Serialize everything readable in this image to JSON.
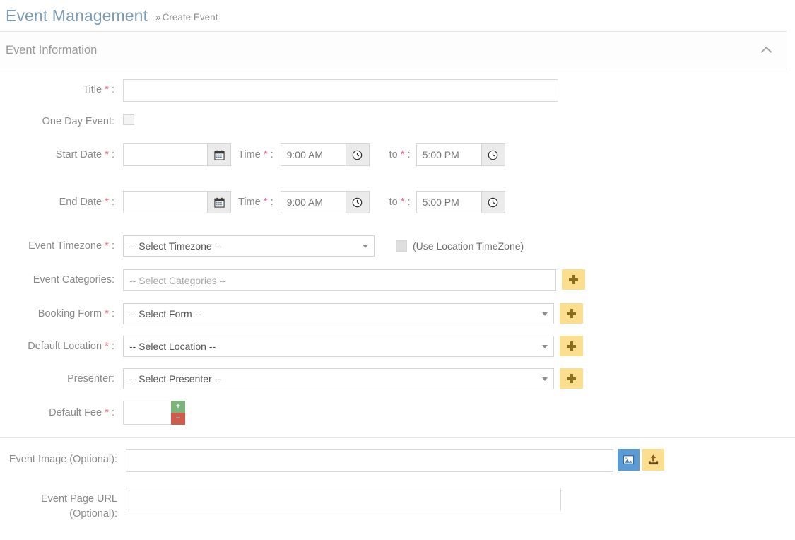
{
  "header": {
    "title": "Event Management",
    "breadcrumb_chevron": "»",
    "breadcrumb": "Create Event"
  },
  "panel": {
    "title": "Event Information",
    "collapse_icon": "chevron-up-icon"
  },
  "form": {
    "title_label": "Title",
    "title_value": "",
    "one_day_label": "One Day Event:",
    "one_day_checked": false,
    "start_date_label": "Start Date",
    "start_date_value": "",
    "start_time_label": "Time",
    "start_time_value": "9:00 AM",
    "start_to_label": "to",
    "start_to_value": "5:00 PM",
    "end_date_label": "End Date",
    "end_date_value": "",
    "end_time_label": "Time",
    "end_time_value": "9:00 AM",
    "end_to_label": "to",
    "end_to_value": "5:00 PM",
    "timezone_label": "Event Timezone",
    "timezone_value": "-- Select Timezone --",
    "use_location_tz_label": "(Use Location TimeZone)",
    "use_location_tz_checked": false,
    "categories_label": "Event Categories:",
    "categories_placeholder": "-- Select Categories --",
    "categories_value": "",
    "booking_form_label": "Booking Form",
    "booking_form_value": "-- Select Form --",
    "default_location_label": "Default Location",
    "default_location_value": "-- Select Location --",
    "presenter_label": "Presenter:",
    "presenter_value": "-- Select Presenter --",
    "default_fee_label": "Default Fee",
    "default_fee_value": "",
    "fee_increment": "+",
    "fee_decrement": "−",
    "event_image_label": "Event Image (Optional):",
    "event_image_value": "",
    "event_page_url_label_line1": "Event Page URL",
    "event_page_url_label_line2": "(Optional):",
    "event_page_url_value": "",
    "required_marker": "*",
    "colon": ":",
    "add_button_icon": "plus-icon",
    "calendar_icon": "calendar-icon",
    "clock_icon": "clock-icon",
    "image_icon": "image-icon",
    "upload_icon": "upload-icon"
  },
  "colors": {
    "page_title": "#7b9cb5",
    "label": "#8a8a8a",
    "required": "#e8687f",
    "add_button": "#fbdf8e",
    "image_button": "#5b9bd5",
    "step_up": "#7bb47b",
    "step_down": "#ce5b4b"
  }
}
